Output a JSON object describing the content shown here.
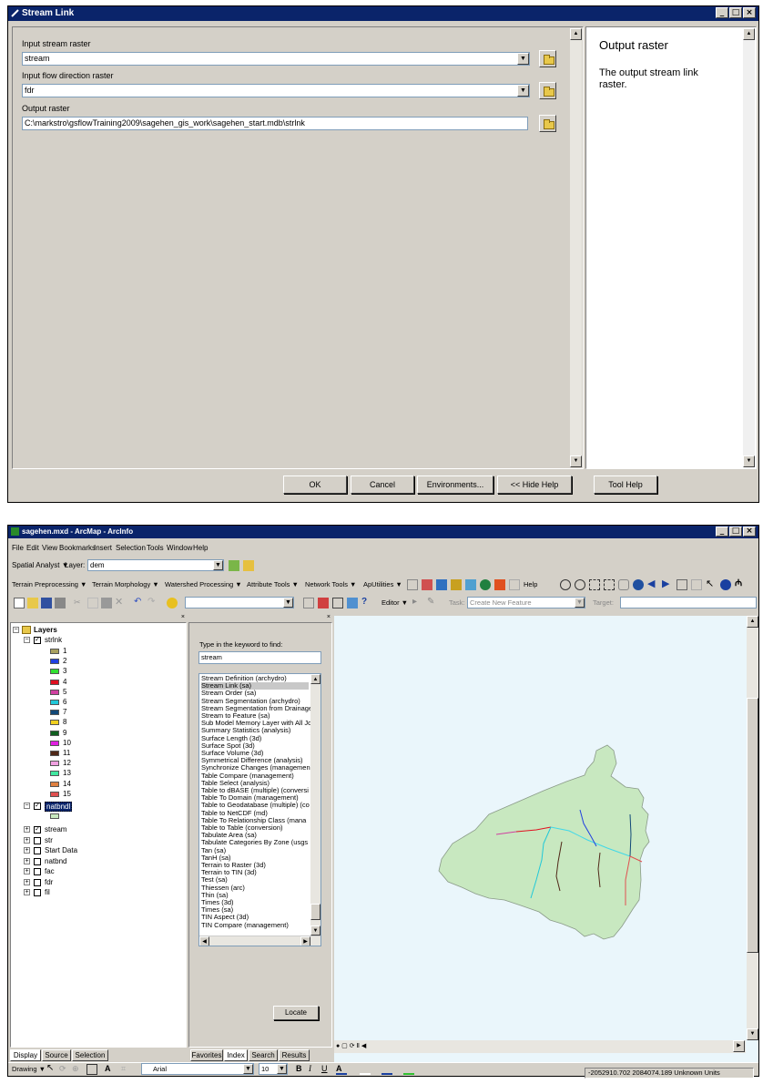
{
  "stream_link_dialog": {
    "title": "Stream Link",
    "window_buttons": [
      "_",
      "□",
      "×"
    ],
    "input_stream_label": "Input stream raster",
    "input_stream_value": "stream",
    "input_flowdir_label": "Input flow direction raster",
    "input_flowdir_value": "fdr",
    "output_raster_label": "Output raster",
    "output_raster_value": "C:\\markstro\\gsflowTraining2009\\sagehen_gis_work\\sagehen_start.mdb\\strlnk",
    "help_title": "Output raster",
    "help_text": "The output stream link raster.",
    "buttons": {
      "ok": "OK",
      "cancel": "Cancel",
      "environments": "Environments...",
      "hide_help": "<< Hide Help",
      "tool_help": "Tool Help"
    }
  },
  "arcmap": {
    "title": "sagehen.mxd - ArcMap - ArcInfo",
    "window_buttons": [
      "_",
      "□",
      "×"
    ],
    "menu": [
      "File",
      "Edit",
      "View",
      "Bookmarks",
      "Insert",
      "Selection",
      "Tools",
      "Window",
      "Help"
    ],
    "spatial_analyst_label": "Spatial Analyst ▼",
    "layer_label": "Layer:",
    "layer_value": "dem",
    "toolbar2": [
      "Terrain Preprocessing ▼",
      "Terrain Morphology ▼",
      "Watershed Processing ▼",
      "Attribute Tools ▼",
      "Network Tools ▼",
      "ApUtilities ▼"
    ],
    "help_label": "Help",
    "editor_label": "Editor ▼",
    "task_label": "Task:",
    "task_value": "Create New Feature",
    "target_label": "Target:",
    "toc": {
      "root": "Layers",
      "strlnk_layer": "strlnk",
      "classes": [
        {
          "label": "1",
          "color": "#a8a060"
        },
        {
          "label": "2",
          "color": "#2040e0"
        },
        {
          "label": "3",
          "color": "#30e030"
        },
        {
          "label": "4",
          "color": "#e01020"
        },
        {
          "label": "5",
          "color": "#d040a0"
        },
        {
          "label": "6",
          "color": "#20c8d8"
        },
        {
          "label": "7",
          "color": "#104878"
        },
        {
          "label": "8",
          "color": "#f0d020"
        },
        {
          "label": "9",
          "color": "#106020"
        },
        {
          "label": "10",
          "color": "#e020e0"
        },
        {
          "label": "11",
          "color": "#502818"
        },
        {
          "label": "12",
          "color": "#f0a0e0"
        },
        {
          "label": "13",
          "color": "#40e8a0"
        },
        {
          "label": "14",
          "color": "#e08040"
        },
        {
          "label": "15",
          "color": "#e05050"
        }
      ],
      "natbndl_layer": "natbndl",
      "other_layers": [
        {
          "label": "stream",
          "checked": true
        },
        {
          "label": "str",
          "checked": false
        },
        {
          "label": "Start Data",
          "checked": false
        },
        {
          "label": "natbnd",
          "checked": false
        },
        {
          "label": "fac",
          "checked": false
        },
        {
          "label": "fdr",
          "checked": false
        },
        {
          "label": "fil",
          "checked": false
        }
      ],
      "tabs": [
        "Display",
        "Source",
        "Selection"
      ]
    },
    "toolbox_index": {
      "prompt": "Type in the keyword to find:",
      "keyword": "stream",
      "items": [
        "Stream Definition (archydro)",
        "Stream Link (sa)",
        "Stream Order (sa)",
        "Stream Segmentation (archydro)",
        "Stream Segmentation from Drainage",
        "Stream to Feature (sa)",
        "Sub Model Memory Layer with All Jo",
        "Summary Statistics (analysis)",
        "Surface Length (3d)",
        "Surface Spot (3d)",
        "Surface Volume (3d)",
        "Symmetrical Difference (analysis)",
        "Synchronize Changes (managemen",
        "Table Compare (management)",
        "Table Select (analysis)",
        "Table to dBASE (multiple) (conversi",
        "Table To Domain (management)",
        "Table to Geodatabase (multiple) (co",
        "Table to NetCDF (md)",
        "Table To Relationship Class (mana",
        "Table to Table (conversion)",
        "Tabulate Area (sa)",
        "Tabulate Categories By Zone (usgs",
        "Tan (sa)",
        "TanH (sa)",
        "Terrain to Raster (3d)",
        "Terrain to TIN (3d)",
        "Test (sa)",
        "Thiessen (arc)",
        "Thin (sa)",
        "Times (3d)",
        "Times (sa)",
        "TIN Aspect (3d)",
        "TIN Compare (management)"
      ],
      "selected_index": 1,
      "locate_button": "Locate",
      "tabs": [
        "Favorites",
        "Index",
        "Search",
        "Results"
      ]
    },
    "drawing_label": "Drawing ▼",
    "font_value": "Arial",
    "font_size": "10",
    "status_coords": "-2052910.702  2084074.189 Unknown Units",
    "colors": {
      "titlebar": "#0a246a",
      "watershed_fill": "#c8e8c0",
      "map_bg": "#eaf6fb"
    }
  }
}
